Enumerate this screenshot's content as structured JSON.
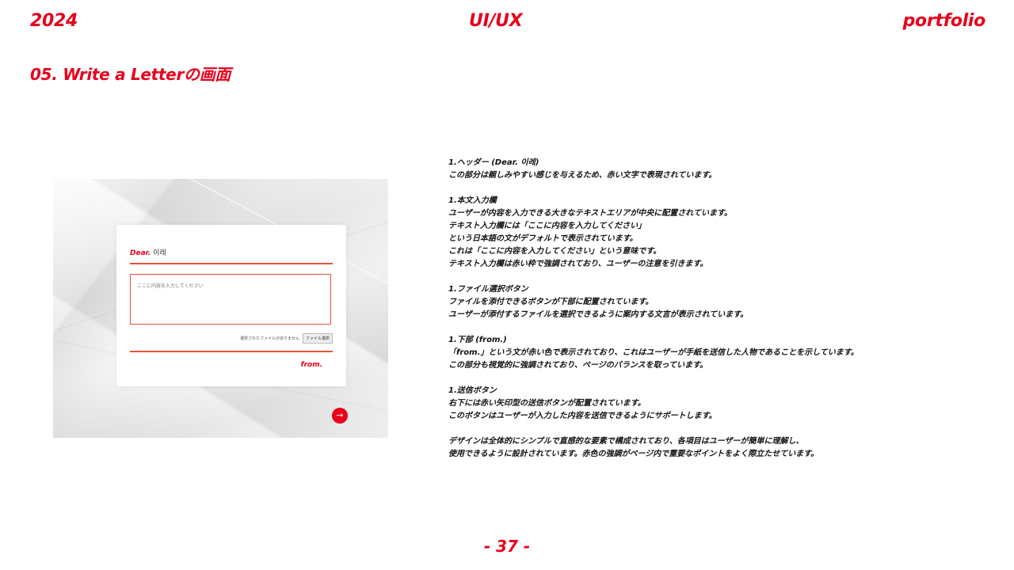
{
  "header": {
    "year": "2024",
    "center": "UI/UX",
    "right": "portfolio"
  },
  "section_title": "05. Write a Letterの画面",
  "screenshot": {
    "dear_word": "Dear.",
    "dear_name": "이레",
    "placeholder": "ここに内容を入力してください",
    "no_file_text": "選択されたファイルがありません",
    "file_button": "ファイル選択",
    "from": "from.",
    "send_icon": "arrow-right-icon",
    "send_glyph": "→"
  },
  "description": {
    "blocks": [
      [
        "1.ヘッダー (Dear. 이레)",
        "この部分は親しみやすい感じを与えるため、赤い文字で表現されています。"
      ],
      [
        "1.本文入力欄",
        "ユーザーが内容を入力できる大きなテキストエリアが中央に配置されています。",
        "テキスト入力欄には「ここに内容を入力してください」",
        "という日本語の文がデフォルトで表示されています。",
        "これは「ここに内容を入力してください」という意味です。",
        "テキスト入力欄は赤い枠で強調されており、ユーザーの注意を引きます。"
      ],
      [
        "1.ファイル選択ボタン",
        "ファイルを添付できるボタンが下部に配置されています。",
        "ユーザーが添付するファイルを選択できるように案内する文言が表示されています。"
      ],
      [
        "1.下部 (from.)",
        "「from.」という文が赤い色で表示されており、これはユーザーが手紙を送信した人物であることを示しています。",
        "この部分も視覚的に強調されており、ページのバランスを取っています。"
      ],
      [
        "1.送信ボタン",
        "右下には赤い矢印型の送信ボタンが配置されています。",
        "このボタンはユーザーが入力した内容を送信できるようにサポートします。"
      ],
      [
        "デザインは全体的にシンプルで直感的な要素で構成されており、各項目はユーザーが簡単に理解し、",
        "使用できるように設計されています。赤色の強調がページ内で重要なポイントをよく際立たせています。"
      ]
    ]
  },
  "page_number": "- 37 -",
  "colors": {
    "accent": "#e8001c",
    "line": "#e8513a"
  }
}
